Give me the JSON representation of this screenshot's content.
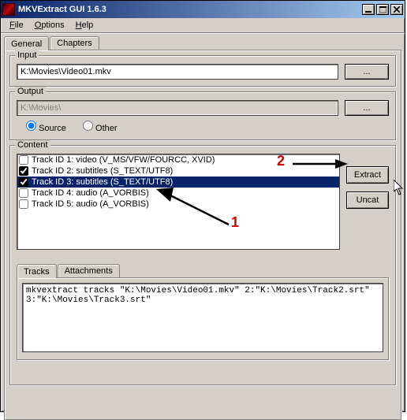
{
  "window": {
    "title": "MKVExtract GUI 1.6.3"
  },
  "menu": {
    "file": "File",
    "options": "Options",
    "help": "Help"
  },
  "tabs": {
    "general": "General",
    "chapters": "Chapters"
  },
  "input": {
    "legend": "Input",
    "path": "K:\\Movies\\Video01.mkv",
    "browse": "..."
  },
  "output": {
    "legend": "Output",
    "path": "K:\\Movies\\",
    "browse": "...",
    "radio_source": "Source",
    "radio_other": "Other"
  },
  "content": {
    "legend": "Content",
    "extract": "Extract",
    "uncat": "Uncat",
    "tracks": [
      {
        "label": "Track ID 1: video (V_MS/VFW/FOURCC, XVID)",
        "checked": false,
        "selected": false
      },
      {
        "label": "Track ID 2: subtitles (S_TEXT/UTF8)",
        "checked": true,
        "selected": false
      },
      {
        "label": "Track ID 3: subtitles (S_TEXT/UTF8)",
        "checked": true,
        "selected": true
      },
      {
        "label": "Track ID 4: audio (A_VORBIS)",
        "checked": false,
        "selected": false
      },
      {
        "label": "Track ID 5: audio (A_VORBIS)",
        "checked": false,
        "selected": false
      }
    ],
    "inner_tabs": {
      "tracks": "Tracks",
      "attachments": "Attachments"
    },
    "command": "mkvextract tracks \"K:\\Movies\\Video01.mkv\" 2:\"K:\\Movies\\Track2.srt\" 3:\"K:\\Movies\\Track3.srt\""
  },
  "annotations": {
    "one": "1",
    "two": "2"
  }
}
